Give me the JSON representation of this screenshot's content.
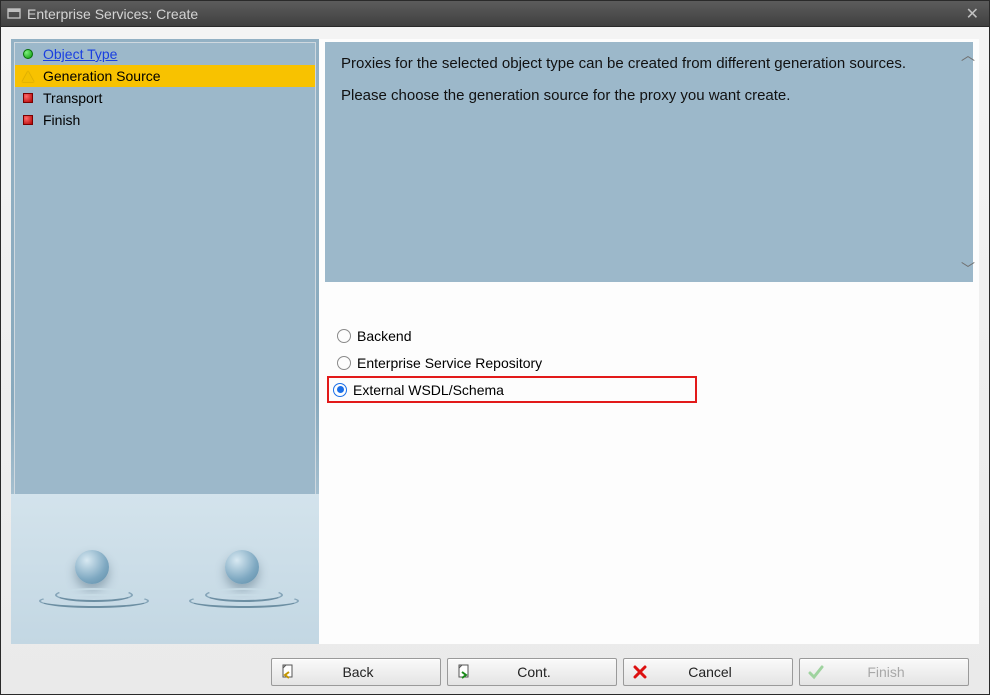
{
  "window": {
    "title": "Enterprise Services: Create"
  },
  "wizard": {
    "steps": [
      {
        "label": "Object Type",
        "state": "completed"
      },
      {
        "label": "Generation Source",
        "state": "current"
      },
      {
        "label": "Transport",
        "state": "pending"
      },
      {
        "label": "Finish",
        "state": "pending"
      }
    ]
  },
  "info": {
    "line1": "Proxies for the selected object type can be created from different generation sources.",
    "line2": "Please choose the generation source for the proxy you want create."
  },
  "options": {
    "items": [
      {
        "label": "Backend",
        "selected": false
      },
      {
        "label": "Enterprise Service Repository",
        "selected": false
      },
      {
        "label": "External WSDL/Schema",
        "selected": true,
        "highlighted": true
      }
    ]
  },
  "buttons": {
    "back": "Back",
    "cont": "Cont.",
    "cancel": "Cancel",
    "finish": "Finish"
  }
}
